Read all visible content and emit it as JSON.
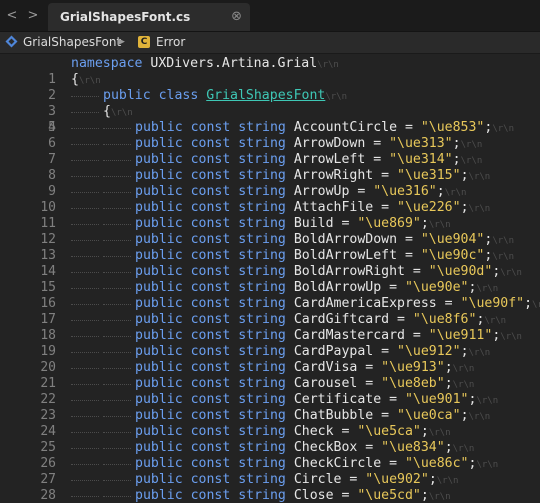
{
  "tab": {
    "title": "GrialShapesFont.cs",
    "close_glyph": "⊗"
  },
  "nav": {
    "back_glyph": "<",
    "forward_glyph": ">"
  },
  "breadcrumb": {
    "project": "GrialShapesFont",
    "separator": "▶",
    "member_badge": "C",
    "member": "Error"
  },
  "eol_marker": "\\r\\n",
  "code": {
    "namespace_kw": "namespace",
    "namespace_name": "UXDivers.Artina.Grial",
    "open_brace": "{",
    "class_modifiers": "public class",
    "class_name": "GrialShapesFont",
    "member_prefix": "public const string",
    "constants": [
      {
        "name": "AccountCircle",
        "value": "\"\\ue853\""
      },
      {
        "name": "ArrowDown",
        "value": "\"\\ue313\""
      },
      {
        "name": "ArrowLeft",
        "value": "\"\\ue314\""
      },
      {
        "name": "ArrowRight",
        "value": "\"\\ue315\""
      },
      {
        "name": "ArrowUp",
        "value": "\"\\ue316\""
      },
      {
        "name": "AttachFile",
        "value": "\"\\ue226\""
      },
      {
        "name": "Build",
        "value": "\"\\ue869\""
      },
      {
        "name": "BoldArrowDown",
        "value": "\"\\ue904\""
      },
      {
        "name": "BoldArrowLeft",
        "value": "\"\\ue90c\""
      },
      {
        "name": "BoldArrowRight",
        "value": "\"\\ue90d\""
      },
      {
        "name": "BoldArrowUp",
        "value": "\"\\ue90e\""
      },
      {
        "name": "CardAmericaExpress",
        "value": "\"\\ue90f\""
      },
      {
        "name": "CardGiftcard",
        "value": "\"\\ue8f6\""
      },
      {
        "name": "CardMastercard",
        "value": "\"\\ue911\""
      },
      {
        "name": "CardPaypal",
        "value": "\"\\ue912\""
      },
      {
        "name": "CardVisa",
        "value": "\"\\ue913\""
      },
      {
        "name": "Carousel",
        "value": "\"\\ue8eb\""
      },
      {
        "name": "Certificate",
        "value": "\"\\ue901\""
      },
      {
        "name": "ChatBubble",
        "value": "\"\\ue0ca\""
      },
      {
        "name": "Check",
        "value": "\"\\ue5ca\""
      },
      {
        "name": "CheckBox",
        "value": "\"\\ue834\""
      },
      {
        "name": "CheckCircle",
        "value": "\"\\ue86c\""
      },
      {
        "name": "Circle",
        "value": "\"\\ue902\""
      },
      {
        "name": "Close",
        "value": "\"\\ue5cd\""
      }
    ]
  },
  "colors": {
    "keyword": "#6b9ff0",
    "class_name": "#3ec7b5",
    "string": "#e8c85a",
    "identifier": "#e6e6e6",
    "line_number": "#808080",
    "background": "#232323"
  }
}
